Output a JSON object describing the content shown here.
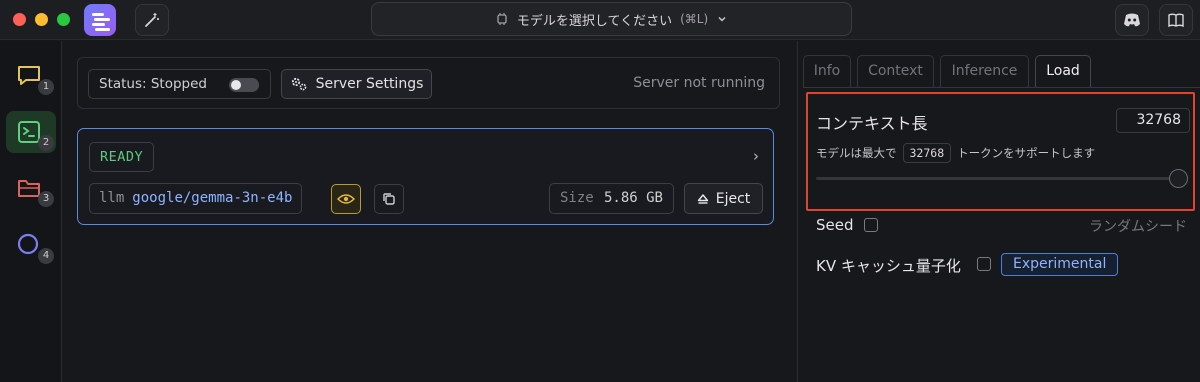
{
  "titlebar": {
    "model_select_label": "モデルを選択してください",
    "model_select_shortcut": "(⌘L)",
    "icons": [
      "wand-icon",
      "chip-icon",
      "chevron-down-icon",
      "discord-icon",
      "book-icon"
    ]
  },
  "rail": {
    "items": [
      {
        "name": "chat",
        "icon": "chat-icon",
        "badge": "1",
        "color": "#e5c35a"
      },
      {
        "name": "developer",
        "icon": "terminal-icon",
        "badge": "2",
        "color": "#5fd07e",
        "active": true
      },
      {
        "name": "my-models",
        "icon": "folder-icon",
        "badge": "3",
        "color": "#e0605a"
      },
      {
        "name": "discover",
        "icon": "search-icon",
        "badge": "4",
        "color": "#7b7ff0"
      }
    ]
  },
  "server": {
    "status_label": "Status: Stopped",
    "status_on": false,
    "settings_label": "Server Settings",
    "state_text": "Server not running"
  },
  "model_card": {
    "status": "READY",
    "prefix": "llm",
    "model_id": "google/gemma-3n-e4b",
    "size_label": "Size",
    "size_value": "5.86 GB",
    "eject_label": "Eject"
  },
  "right_panel": {
    "tabs": [
      "Info",
      "Context",
      "Inference",
      "Load"
    ],
    "active_tab": "Load",
    "context_length": {
      "title": "コンテキスト長",
      "value": "32768",
      "desc_prefix": "モデルは最大で",
      "desc_value": "32768",
      "desc_suffix": "トークンをサポートします",
      "slider_fraction": 1.0
    },
    "seed": {
      "label": "Seed",
      "checked": false,
      "hint": "ランダムシード"
    },
    "kv_cache": {
      "label": "KV キャッシュ量子化",
      "checked": false,
      "badge": "Experimental"
    }
  },
  "colors": {
    "accent_blue": "#5b8ae0",
    "ready_green": "#5fc97e",
    "highlight_red": "#e0442f"
  }
}
